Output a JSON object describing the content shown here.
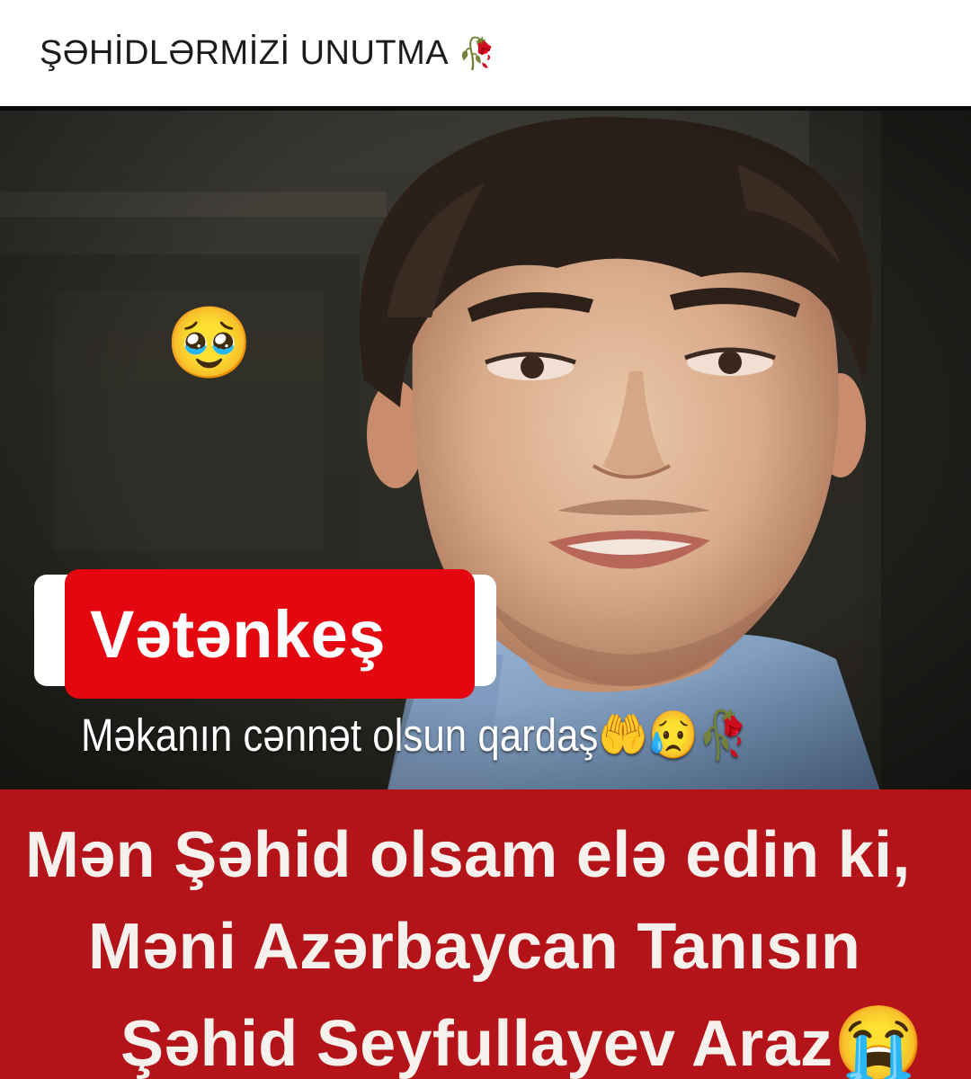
{
  "post": {
    "caption": "ŞƏHİDLƏRMİZİ UNUTMA",
    "caption_emoji": "🥀"
  },
  "photo": {
    "crying_emoji": "🥹",
    "badge_text": "Vətənkeş",
    "subtitle_text": "Məkanın cənnət olsun qardaş",
    "subtitle_emojis": "🤲😥🥀",
    "quote": {
      "line1": "Mən Şəhid olsam elə edin ki,",
      "line2": "Məni Azərbaycan Tanısın",
      "line3": "Şəhid Seyfullayev Araz",
      "line3_emoji": "😭"
    }
  },
  "colors": {
    "badge_red": "#e4070f",
    "panel_red": "#b4131a",
    "text_light": "#f6f1ec"
  }
}
